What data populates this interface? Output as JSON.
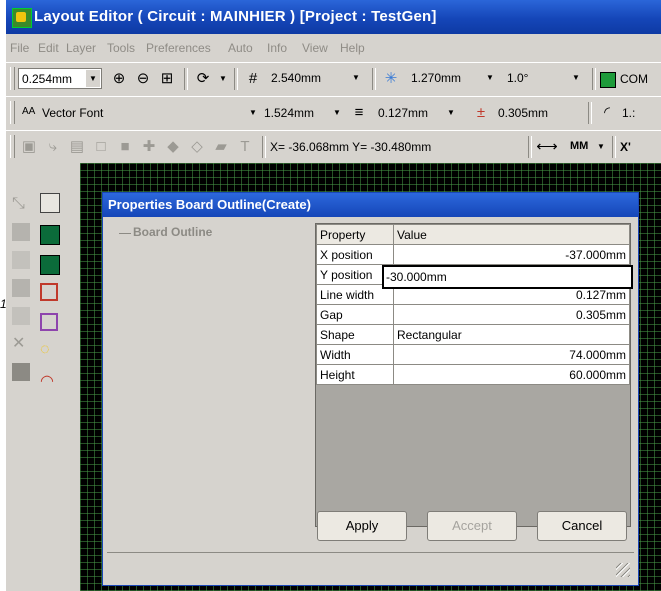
{
  "title": "Layout Editor ( Circuit : MAINHIER ) [Project : TestGen]",
  "menu": [
    "File",
    "Edit",
    "Layer",
    "Tools",
    "Preferences",
    "Auto",
    "Info",
    "View",
    "Help"
  ],
  "toolbar1": {
    "zoom_step": "0.254mm",
    "grid_value": "2.540mm",
    "snap_value": "1.270mm",
    "angle_value": "1.0°",
    "layer_label": "COM"
  },
  "toolbar2": {
    "font_label": "Vector Font",
    "text_height": "1.524mm",
    "line_width": "0.127mm",
    "clearance": "0.305mm",
    "extra": "1.:"
  },
  "toolbar3": {
    "coords": "X= -36.068mm  Y= -30.480mm",
    "unit": "MM",
    "extra": "X'"
  },
  "dialog": {
    "title": "Properties Board Outline(Create)",
    "tree_item": "Board Outline",
    "headers": [
      "Property",
      "Value"
    ],
    "rows": [
      {
        "key": "X position",
        "value": "-37.000mm"
      },
      {
        "key": "Y position",
        "value": "-30.000mm"
      },
      {
        "key": "Line width",
        "value": "0.127mm"
      },
      {
        "key": "Gap",
        "value": "0.305mm"
      },
      {
        "key": "Shape",
        "value": "Rectangular"
      },
      {
        "key": "Width",
        "value": "74.000mm"
      },
      {
        "key": "Height",
        "value": "60.000mm"
      }
    ],
    "editing_value": "-30.000mm",
    "apply_label": "Apply",
    "accept_label": "Accept",
    "cancel_label": "Cancel"
  },
  "annotation_marker": "1",
  "colors": {
    "title_bar": "#1546b8",
    "canvas_bg": "#000000",
    "grid_dots": "#2e8b2e"
  }
}
